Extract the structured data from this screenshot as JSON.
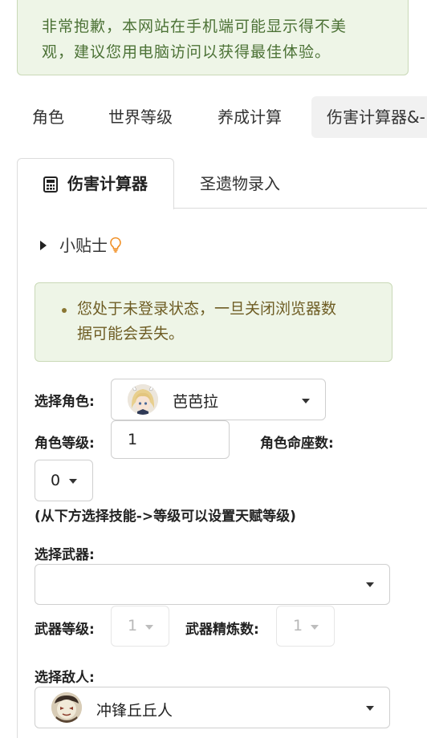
{
  "notice": {
    "line1": "非常抱歉，本网站在手机端可能显示得不美",
    "line2": "观，建议您用电脑访问以获得最佳体验。"
  },
  "top_tabs": [
    {
      "label": "角色"
    },
    {
      "label": "世界等级"
    },
    {
      "label": "养成计算"
    },
    {
      "label": "伤害计算器&-"
    }
  ],
  "sub_tabs": {
    "active_label": "伤害计算器",
    "icon": "calculator-icon",
    "other_label": "圣遗物录入"
  },
  "tips": {
    "label": "小贴士",
    "icon": "lightbulb-icon"
  },
  "alert": {
    "line1": "您处于未登录状态，一旦关闭浏览器数",
    "line2": "据可能会丢失。"
  },
  "form": {
    "character_label": "选择角色:",
    "character_value": "芭芭拉",
    "level_label": "角色等级:",
    "level_value": "1",
    "constellation_label": "角色命座数:",
    "constellation_value": "0",
    "hint": "(从下方选择技能->等级可以设置天赋等级)",
    "weapon_label": "选择武器:",
    "weapon_value": "",
    "weapon_level_label": "武器等级:",
    "weapon_level_value": "1",
    "refine_label": "武器精炼数:",
    "refine_value": "1",
    "enemy_label": "选择敌人:",
    "enemy_value": "冲锋丘丘人"
  },
  "colors": {
    "notice_bg": "#eef5e7",
    "notice_text": "#4c7236",
    "alert_text": "#6e5d24"
  }
}
